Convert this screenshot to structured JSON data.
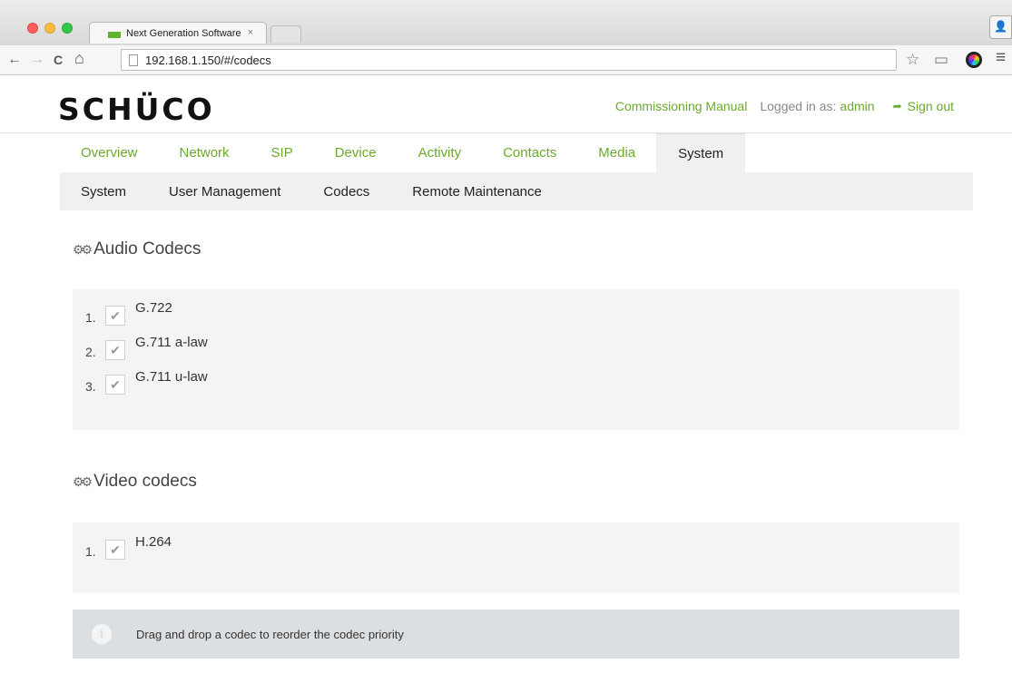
{
  "browser": {
    "tab_title": "Next Generation Software",
    "tab_close": "×",
    "url": "192.168.1.150/#/codecs",
    "icons": [
      "back-icon",
      "forward-icon",
      "reload-icon",
      "home-icon",
      "page-icon",
      "star-icon",
      "cast-icon",
      "color-extension-icon",
      "menu-icon",
      "profile-icon"
    ],
    "glyphs": {
      "back": "←",
      "forward": "→",
      "reload": "C",
      "home": "⌂",
      "star": "☆",
      "cast": "▭",
      "menu": "≡",
      "profile": "👤"
    }
  },
  "header": {
    "logo": "SCHÜCO",
    "manual_link": "Commissioning Manual",
    "logged_in_label": "Logged in as:",
    "user": "admin",
    "sign_out": "Sign out",
    "sign_out_glyph": "➦"
  },
  "nav": {
    "main_tabs": [
      "Overview",
      "Network",
      "SIP",
      "Device",
      "Activity",
      "Contacts",
      "Media",
      "System"
    ],
    "active_main": "System",
    "sub_tabs": [
      "System",
      "User Management",
      "Codecs",
      "Remote Maintenance"
    ]
  },
  "audio": {
    "title": "Audio Codecs",
    "codecs": [
      {
        "num": "1.",
        "name": "G.722",
        "checked": true
      },
      {
        "num": "2.",
        "name": "G.711 a-law",
        "checked": true
      },
      {
        "num": "3.",
        "name": "G.711 u-law",
        "checked": true
      }
    ]
  },
  "video": {
    "title": "Video codecs",
    "codecs": [
      {
        "num": "1.",
        "name": "H.264",
        "checked": true
      }
    ]
  },
  "info": {
    "glyph": "i",
    "text": "Drag and drop a codec to reorder the codec priority"
  },
  "glyphs": {
    "gear": "⚙⚙",
    "check": "✔"
  },
  "colors": {
    "accent": "#6aaa2c",
    "panel": "#f4f4f4",
    "info_bar": "#dcdfe2"
  }
}
